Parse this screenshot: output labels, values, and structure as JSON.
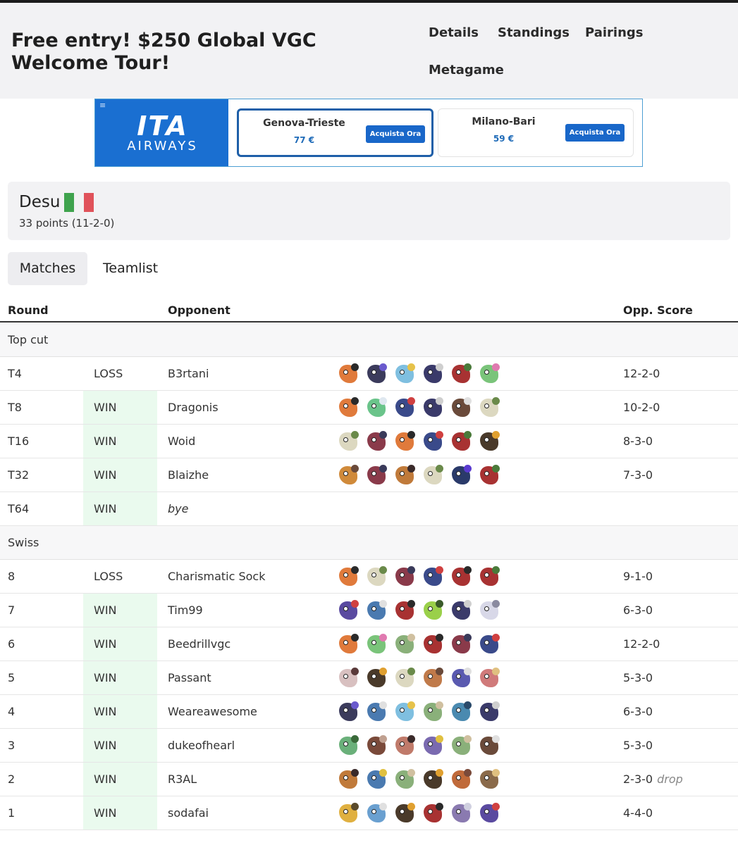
{
  "header": {
    "title": "Free entry! $250 Global VGC Welcome Tour!",
    "nav": [
      "Details",
      "Standings",
      "Pairings",
      "Metagame"
    ]
  },
  "ad": {
    "logo_main": "ITA",
    "logo_sub": "AIRWAYS",
    "offers": [
      {
        "route": "Genova-Trieste",
        "price": "77 €",
        "button": "Acquista Ora"
      },
      {
        "route": "Milano-Bari",
        "price": "59 €",
        "button": "Acquista Ora"
      }
    ]
  },
  "player": {
    "name": "Desu",
    "flag_colors": [
      "#3fa34d",
      "#f2f2f2",
      "#e0525a"
    ],
    "points": "33 points (11-2-0)"
  },
  "tabs": [
    "Matches",
    "Teamlist"
  ],
  "table": {
    "headers": {
      "round": "Round",
      "opponent": "Opponent",
      "score": "Opp. Score"
    },
    "sections": [
      {
        "name": "Top cut",
        "rows": [
          {
            "round": "T4",
            "result": "LOSS",
            "opponent": "B3rtani",
            "score": "12-2-0",
            "drop": "",
            "bye": false,
            "team": [
              [
                "#e07a3b",
                "#2a2a2a"
              ],
              [
                "#3b3b5c",
                "#6a5acd"
              ],
              [
                "#7fbfe0",
                "#e6c24a"
              ],
              [
                "#3a3a6a",
                "#cfcfcf"
              ],
              [
                "#a83232",
                "#4a7a3a"
              ],
              [
                "#7ac47a",
                "#e07ab0"
              ]
            ]
          },
          {
            "round": "T8",
            "result": "WIN",
            "opponent": "Dragonis",
            "score": "10-2-0",
            "drop": "",
            "bye": false,
            "team": [
              [
                "#e07a3b",
                "#2a2a2a"
              ],
              [
                "#6ac48a",
                "#dfe8f0"
              ],
              [
                "#3a4a8a",
                "#d04040"
              ],
              [
                "#3a3a6a",
                "#cfcfcf"
              ],
              [
                "#6a4a3a",
                "#e0e0e0"
              ],
              [
                "#dcd8c0",
                "#6a8a4a"
              ]
            ]
          },
          {
            "round": "T16",
            "result": "WIN",
            "opponent": "Woid",
            "score": "8-3-0",
            "drop": "",
            "bye": false,
            "team": [
              [
                "#dcd8c0",
                "#6a8a4a"
              ],
              [
                "#8a3a4a",
                "#3a3a5a"
              ],
              [
                "#e07a3b",
                "#2a2a2a"
              ],
              [
                "#3a4a8a",
                "#d04040"
              ],
              [
                "#a83232",
                "#4a7a3a"
              ],
              [
                "#4a3a2a",
                "#e0a030"
              ]
            ]
          },
          {
            "round": "T32",
            "result": "WIN",
            "opponent": "Blaizhe",
            "score": "7-3-0",
            "drop": "",
            "bye": false,
            "team": [
              [
                "#d08a3a",
                "#6a4a3a"
              ],
              [
                "#8a3a4a",
                "#3a3a5a"
              ],
              [
                "#c07a3a",
                "#3a2a2a"
              ],
              [
                "#dcd8c0",
                "#6a8a4a"
              ],
              [
                "#2a3a6a",
                "#5a3ad0"
              ],
              [
                "#a83232",
                "#4a7a3a"
              ]
            ]
          },
          {
            "round": "T64",
            "result": "WIN",
            "opponent": "bye",
            "score": "",
            "drop": "",
            "bye": true,
            "team": []
          }
        ]
      },
      {
        "name": "Swiss",
        "rows": [
          {
            "round": "8",
            "result": "LOSS",
            "opponent": "Charismatic Sock",
            "score": "9-1-0",
            "drop": "",
            "bye": false,
            "team": [
              [
                "#e07a3b",
                "#2a2a2a"
              ],
              [
                "#dcd8c0",
                "#6a8a4a"
              ],
              [
                "#8a3a4a",
                "#3a3a5a"
              ],
              [
                "#3a4a8a",
                "#d04040"
              ],
              [
                "#a83232",
                "#2a2a2a"
              ],
              [
                "#a83232",
                "#4a7a3a"
              ]
            ]
          },
          {
            "round": "7",
            "result": "WIN",
            "opponent": "Tim99",
            "score": "6-3-0",
            "drop": "",
            "bye": false,
            "team": [
              [
                "#5a4aa0",
                "#d04040"
              ],
              [
                "#4a7ab0",
                "#e0e0e0"
              ],
              [
                "#a83232",
                "#2a2a2a"
              ],
              [
                "#9ad04a",
                "#3a5a2a"
              ],
              [
                "#3a3a6a",
                "#cfcfcf"
              ],
              [
                "#d8d8e8",
                "#8a8aa0"
              ]
            ]
          },
          {
            "round": "6",
            "result": "WIN",
            "opponent": "Beedrillvgc",
            "score": "12-2-0",
            "drop": "",
            "bye": false,
            "team": [
              [
                "#e07a3b",
                "#2a2a2a"
              ],
              [
                "#7ac47a",
                "#e07ab0"
              ],
              [
                "#8ab07a",
                "#d0c0a0"
              ],
              [
                "#a83232",
                "#2a2a2a"
              ],
              [
                "#8a3a4a",
                "#3a3a5a"
              ],
              [
                "#3a4a8a",
                "#d04040"
              ]
            ]
          },
          {
            "round": "5",
            "result": "WIN",
            "opponent": "Passant",
            "score": "5-3-0",
            "drop": "",
            "bye": false,
            "team": [
              [
                "#d8c0c0",
                "#5a3a3a"
              ],
              [
                "#4a3a2a",
                "#e0a030"
              ],
              [
                "#dcd8c0",
                "#6a8a4a"
              ],
              [
                "#c07a4a",
                "#6a4a3a"
              ],
              [
                "#5a5ab0",
                "#e0e0e0"
              ],
              [
                "#d07a7a",
                "#e0c080"
              ]
            ]
          },
          {
            "round": "4",
            "result": "WIN",
            "opponent": "Weareawesome",
            "score": "6-3-0",
            "drop": "",
            "bye": false,
            "team": [
              [
                "#3b3b5c",
                "#6a5acd"
              ],
              [
                "#4a7ab0",
                "#e0e0e0"
              ],
              [
                "#7fbfe0",
                "#e6c24a"
              ],
              [
                "#8ab07a",
                "#d0c0a0"
              ],
              [
                "#4a8ab0",
                "#2a4a6a"
              ],
              [
                "#3a3a6a",
                "#cfcfcf"
              ]
            ]
          },
          {
            "round": "3",
            "result": "WIN",
            "opponent": "dukeofhearl",
            "score": "5-3-0",
            "drop": "",
            "bye": false,
            "team": [
              [
                "#6ab07a",
                "#3a6a3a"
              ],
              [
                "#7a4a3a",
                "#c0a090"
              ],
              [
                "#c07a6a",
                "#3a2a2a"
              ],
              [
                "#7a6ab0",
                "#e0c040"
              ],
              [
                "#8ab07a",
                "#d0c0a0"
              ],
              [
                "#6a4a3a",
                "#e0e0e0"
              ]
            ]
          },
          {
            "round": "2",
            "result": "WIN",
            "opponent": "R3AL",
            "score": "2-3-0",
            "drop": "drop",
            "bye": false,
            "team": [
              [
                "#c07a3a",
                "#3a2a2a"
              ],
              [
                "#4a7ab0",
                "#e0c040"
              ],
              [
                "#8ab07a",
                "#d0c0a0"
              ],
              [
                "#4a3a2a",
                "#e0a030"
              ],
              [
                "#c06a3a",
                "#7a4a3a"
              ],
              [
                "#8a6a4a",
                "#e0c080"
              ]
            ]
          },
          {
            "round": "1",
            "result": "WIN",
            "opponent": "sodafai",
            "score": "4-4-0",
            "drop": "",
            "bye": false,
            "team": [
              [
                "#e0b040",
                "#5a4a2a"
              ],
              [
                "#6aa0d0",
                "#e0e0e0"
              ],
              [
                "#4a3a2a",
                "#e0a030"
              ],
              [
                "#a83232",
                "#2a2a2a"
              ],
              [
                "#8a7ab0",
                "#d0d0e0"
              ],
              [
                "#5a4aa0",
                "#d04040"
              ]
            ]
          }
        ]
      }
    ]
  }
}
